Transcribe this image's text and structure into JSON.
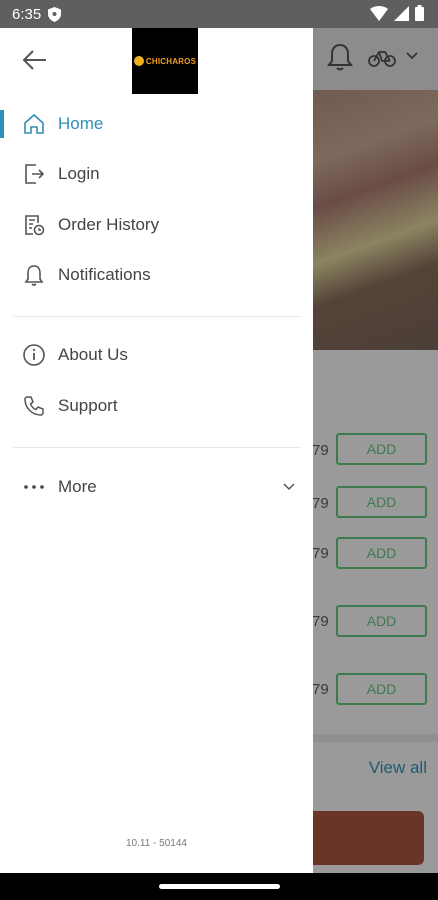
{
  "status_bar": {
    "time": "6:35"
  },
  "background": {
    "add_label": "ADD",
    "prices": [
      "79",
      "79",
      "79",
      "79",
      "79"
    ],
    "view_all": "View all"
  },
  "drawer": {
    "logo_text": "CHICHAROS",
    "menu": {
      "home": "Home",
      "login": "Login",
      "order_history": "Order History",
      "notifications": "Notifications",
      "about_us": "About Us",
      "support": "Support",
      "more": "More"
    },
    "version": "10.11 - 50144"
  },
  "colors": {
    "accent": "#2f8fb4",
    "add_green": "#3f7a4f",
    "scrim": "#9a9a9a"
  }
}
